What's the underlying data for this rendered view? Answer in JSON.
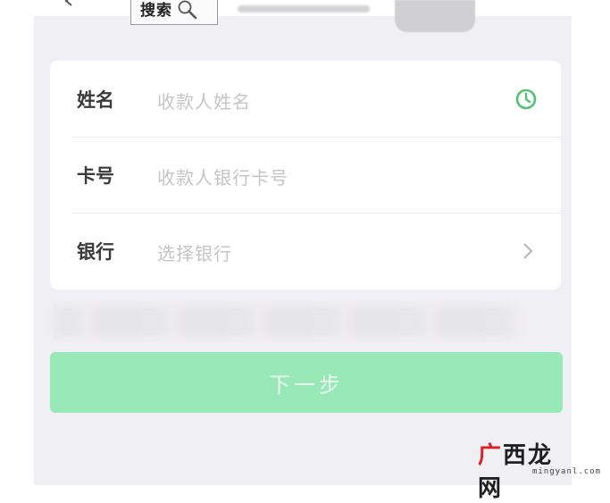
{
  "search_chip": {
    "label": "搜索",
    "icon": "magnifier-icon"
  },
  "form": {
    "rows": [
      {
        "label": "姓名",
        "placeholder": "收款人姓名",
        "icon": "clock-icon"
      },
      {
        "label": "卡号",
        "placeholder": "收款人银行卡号"
      },
      {
        "label": "银行",
        "placeholder": "选择银行",
        "icon": "chevron-right-icon"
      }
    ]
  },
  "next_button": {
    "label": "下一步"
  },
  "watermark": {
    "logo_first": "广",
    "logo_rest": "西龙网",
    "url": "mingyanl.com"
  },
  "colors": {
    "page_bg": "#f0eff3",
    "button_disabled": "#98e8b8",
    "accent_green": "#54c172",
    "placeholder": "#c5c5c8"
  }
}
